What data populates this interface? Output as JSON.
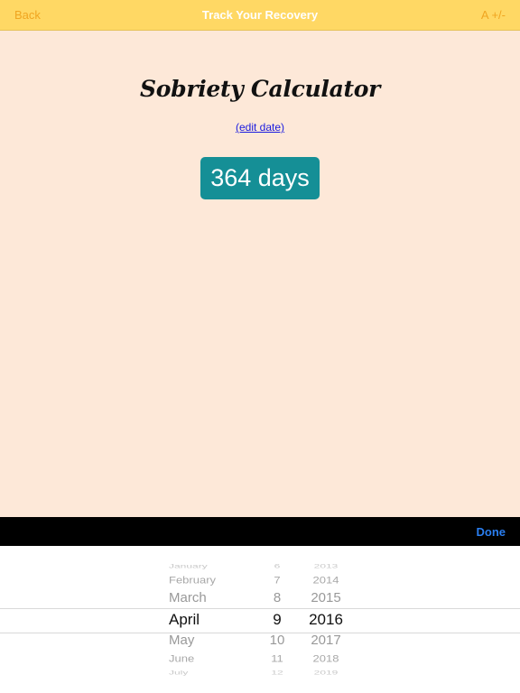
{
  "nav": {
    "back_label": "Back",
    "title": "Track Your Recovery",
    "font_size_label": "A +/-"
  },
  "main": {
    "heading": "Sobriety Calculator",
    "edit_link": "(edit date)",
    "days_count": "364 days"
  },
  "toolbar": {
    "done_label": "Done"
  },
  "colors": {
    "nav_bg": "#ffd864",
    "nav_button": "#f0a520",
    "content_bg": "#fde8d8",
    "badge_bg": "#158f96",
    "link": "#1a1adf",
    "done": "#2a7ef0"
  },
  "picker": {
    "months": [
      "January",
      "February",
      "March",
      "April",
      "May",
      "June",
      "July"
    ],
    "days": [
      "6",
      "7",
      "8",
      "9",
      "10",
      "11",
      "12"
    ],
    "years": [
      "2013",
      "2014",
      "2015",
      "2016",
      "2017",
      "2018",
      "2019"
    ],
    "selected": {
      "month": "April",
      "day": "9",
      "year": "2016"
    }
  }
}
